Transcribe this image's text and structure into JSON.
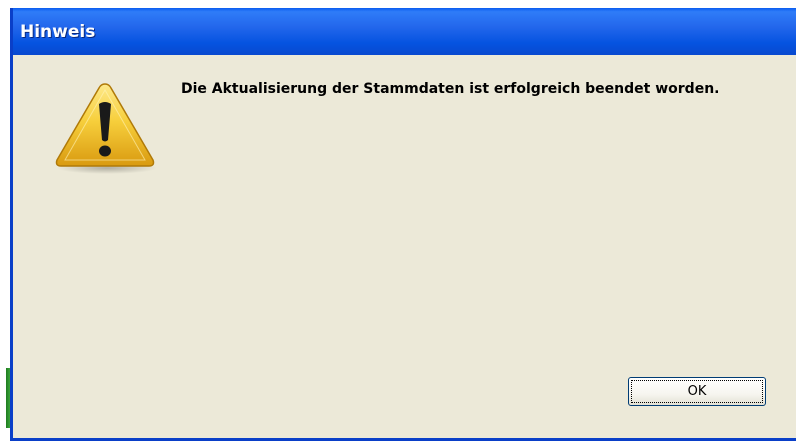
{
  "dialog": {
    "title": "Hinweis",
    "icon": "warning-icon",
    "message": "Die Aktualisierung der Stammdaten ist erfolgreich beendet worden.",
    "ok_label": "OK"
  },
  "colors": {
    "titlebar": "#0553e0",
    "dialog_background": "#ece9d8",
    "warning_yellow": "#f2c12e"
  }
}
